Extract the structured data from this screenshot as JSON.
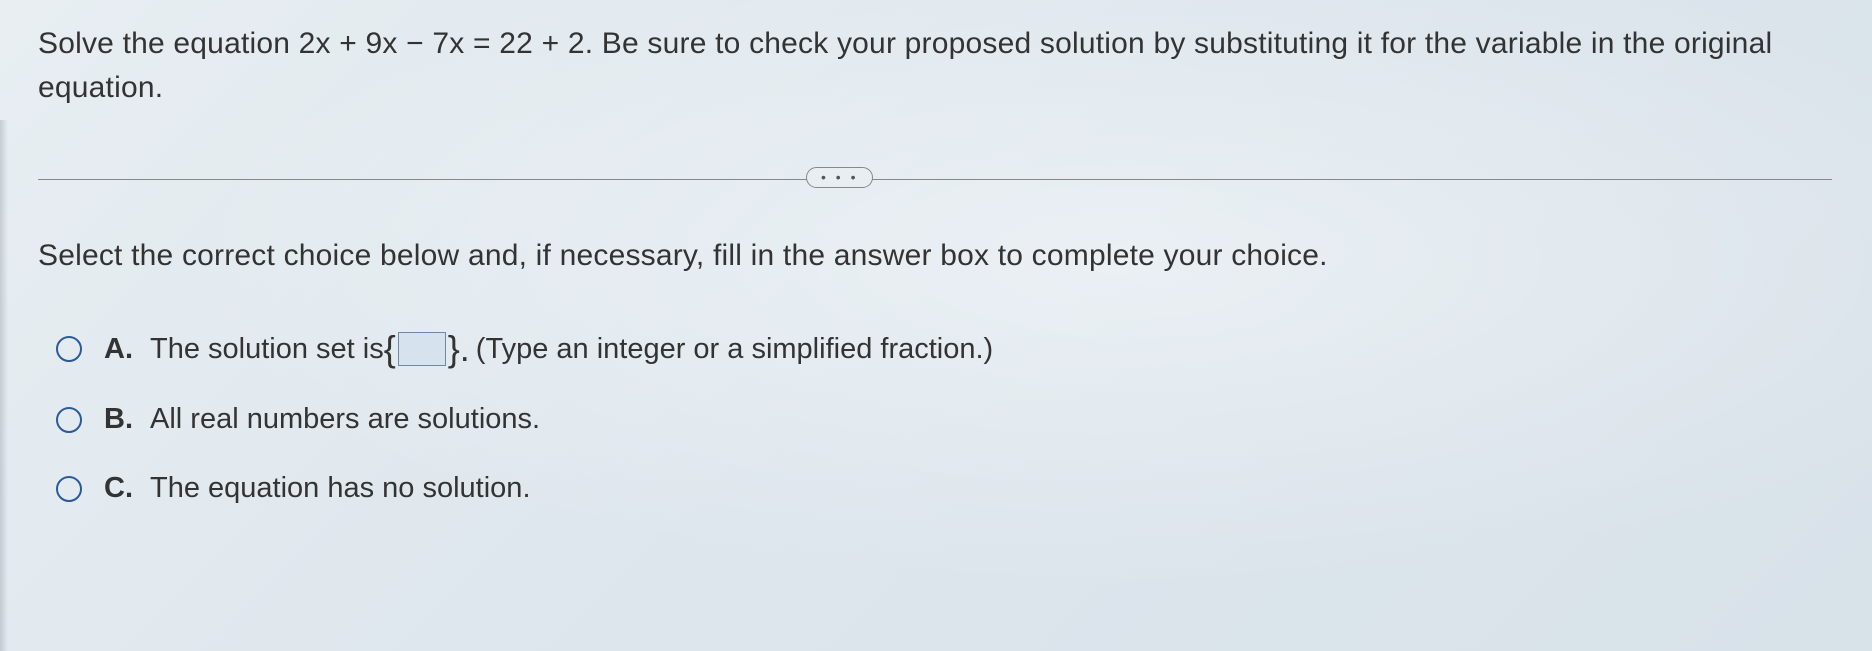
{
  "question": "Solve the equation 2x + 9x − 7x = 22 + 2. Be sure to check your proposed solution by substituting it for the variable in the original equation.",
  "divider_dots": "• • •",
  "instruction": "Select the correct choice below and, if necessary, fill in the answer box to complete your choice.",
  "options": {
    "a": {
      "label": "A.",
      "text_before": "The solution set is ",
      "brace_open": "{",
      "answer_value": "",
      "brace_close": "}.",
      "hint": "(Type an integer or a simplified fraction.)"
    },
    "b": {
      "label": "B.",
      "text": "All real numbers are solutions."
    },
    "c": {
      "label": "C.",
      "text": "The equation has no solution."
    }
  }
}
